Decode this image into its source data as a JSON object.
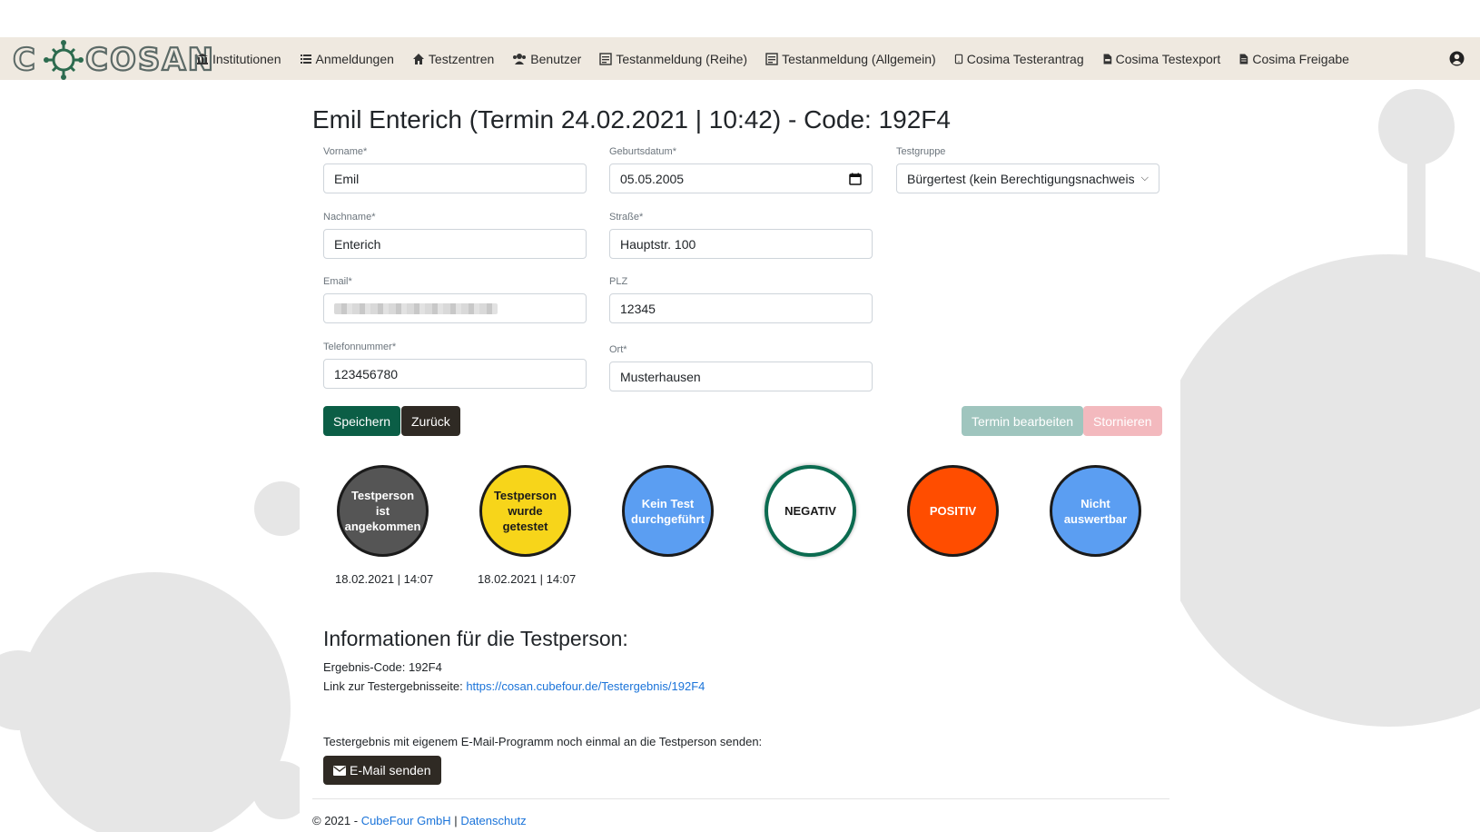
{
  "app": {
    "logo_text": "COSAN"
  },
  "nav": {
    "items": [
      {
        "label": "Institutionen",
        "icon": "institution-icon"
      },
      {
        "label": "Anmeldungen",
        "icon": "list-icon"
      },
      {
        "label": "Testzentren",
        "icon": "home-icon"
      },
      {
        "label": "Benutzer",
        "icon": "users-icon"
      },
      {
        "label": "Testanmeldung (Reihe)",
        "icon": "form-icon"
      },
      {
        "label": "Testanmeldung (Allgemein)",
        "icon": "form-icon"
      },
      {
        "label": "Cosima Testerantrag",
        "icon": "mobile-icon"
      },
      {
        "label": "Cosima Testexport",
        "icon": "file-csv-icon"
      },
      {
        "label": "Cosima Freigabe",
        "icon": "file-icon"
      }
    ]
  },
  "page": {
    "title": "Emil Enterich (Termin 24.02.2021 | 10:42) - Code: 192F4"
  },
  "form": {
    "vorname": {
      "label": "Vorname*",
      "value": "Emil"
    },
    "nachname": {
      "label": "Nachname*",
      "value": "Enterich"
    },
    "email": {
      "label": "Email*",
      "value": ""
    },
    "telefon": {
      "label": "Telefonnummer*",
      "value": "123456780"
    },
    "geburtsdatum": {
      "label": "Geburtsdatum*",
      "value": "05.05.2005"
    },
    "strasse": {
      "label": "Straße*",
      "value": "Hauptstr. 100"
    },
    "plz": {
      "label": "PLZ",
      "value": "12345"
    },
    "ort": {
      "label": "Ort*",
      "value": "Musterhausen"
    },
    "testgruppe": {
      "label": "Testgruppe",
      "value": "Bürgertest (kein Berechtigungsnachweis e"
    }
  },
  "buttons": {
    "save": "Speichern",
    "back": "Zurück",
    "edit_appointment": "Termin bearbeiten",
    "cancel": "Stornieren"
  },
  "statuses": [
    {
      "lines": [
        "Testperson",
        "ist",
        "angekommen"
      ],
      "timestamp": "18.02.2021 | 14:07",
      "color": "#555555"
    },
    {
      "lines": [
        "Testperson",
        "wurde",
        "getestet"
      ],
      "timestamp": "18.02.2021 | 14:07",
      "color": "#f7d51a"
    },
    {
      "lines": [
        "Kein Test",
        "durchgeführt"
      ],
      "timestamp": "",
      "color": "#5b9ef2"
    },
    {
      "lines": [
        "NEGATIV"
      ],
      "timestamp": "",
      "color": "#ffffff"
    },
    {
      "lines": [
        "POSITIV"
      ],
      "timestamp": "",
      "color": "#ff4d00"
    },
    {
      "lines": [
        "Nicht",
        "auswertbar"
      ],
      "timestamp": "",
      "color": "#5b9ef2"
    }
  ],
  "info": {
    "title": "Informationen für die Testperson:",
    "code_label": "Ergebnis-Code: 192F4",
    "link_label": "Link zur Testergebnisseite:",
    "link_url": "https://cosan.cubefour.de/Testergebnis/192F4",
    "resend_text": "Testergebnis mit eigenem E-Mail-Programm noch einmal an die Testperson senden:",
    "email_button": "E-Mail senden"
  },
  "footer": {
    "copyright": "© 2021 -",
    "company": "CubeFour GmbH",
    "separator": "|",
    "privacy": "Datenschutz"
  },
  "colors": {
    "navbar_bg": "#efe9e0",
    "primary_green": "#0b5e46",
    "dark_button": "#2f2a24",
    "muted_green": "#9fc5be",
    "muted_red": "#f3b9be",
    "link": "#1a73d9"
  }
}
